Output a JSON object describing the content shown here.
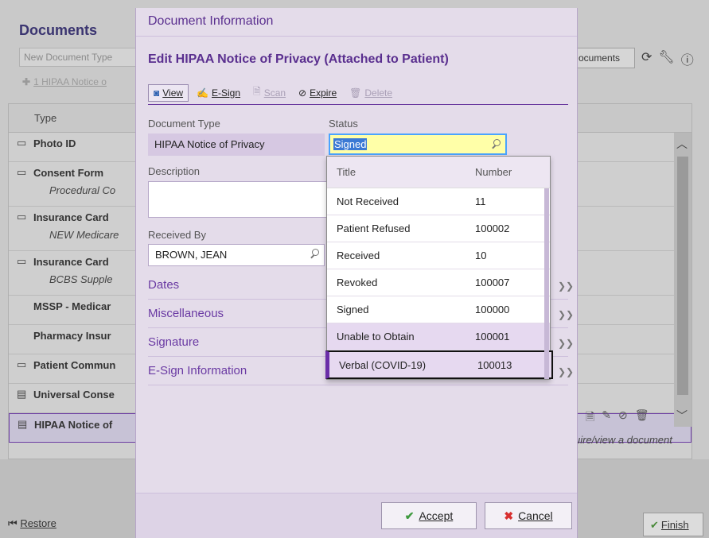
{
  "background": {
    "title": "Documents",
    "new_doc_placeholder": "New Document Type",
    "attach_label": "1 HIPAA Notice o",
    "right_btn_label": "ocuments",
    "grid_header": "Type",
    "rows": [
      {
        "label": "Photo ID",
        "sub": "",
        "icon": "document-icon"
      },
      {
        "label": "Consent Form",
        "sub": "Procedural Co",
        "icon": "document-icon"
      },
      {
        "label": "Insurance Card",
        "sub": "NEW Medicare",
        "icon": "document-icon"
      },
      {
        "label": "Insurance Card",
        "sub": "BCBS Supple",
        "icon": "document-icon"
      },
      {
        "label": "MSSP - Medicar",
        "sub": "",
        "icon": ""
      },
      {
        "label": "Pharmacy Insur",
        "sub": "",
        "icon": ""
      },
      {
        "label": "Patient Commun",
        "sub": "",
        "icon": "document-icon"
      },
      {
        "label": "Universal Conse",
        "sub": "",
        "icon": "signed-document-icon"
      },
      {
        "label": "HIPAA Notice of",
        "sub": "",
        "icon": "signed-document-icon"
      }
    ],
    "hint": "uire/view a document",
    "restore_label": "Restore",
    "finish_label": "Finish"
  },
  "modal": {
    "header": "Document Information",
    "subtitle": "Edit HIPAA Notice of Privacy (Attached to Patient)",
    "toolbar": {
      "view": "View",
      "esign": "E-Sign",
      "scan": "Scan",
      "expire": "Expire",
      "delete": "Delete"
    },
    "document_type_label": "Document Type",
    "document_type_value": "HIPAA Notice of Privacy",
    "status_label": "Status",
    "status_value": "Signed",
    "description_label": "Description",
    "description_value": "",
    "received_by_label": "Received By",
    "received_by_value": "BROWN, JEAN",
    "sections": [
      "Dates",
      "Miscellaneous",
      "Signature",
      "E-Sign Information"
    ],
    "accept_label": "Accept",
    "cancel_label": "Cancel"
  },
  "dropdown": {
    "col_title": "Title",
    "col_number": "Number",
    "options": [
      {
        "title": "Not Received",
        "number": "11"
      },
      {
        "title": "Patient Refused",
        "number": "100002"
      },
      {
        "title": "Received",
        "number": "10"
      },
      {
        "title": "Revoked",
        "number": "100007"
      },
      {
        "title": "Signed",
        "number": "100000"
      },
      {
        "title": "Unable to Obtain",
        "number": "100001"
      },
      {
        "title": "Verbal (COVID-19)",
        "number": "100013"
      }
    ]
  },
  "colors": {
    "accent_purple": "#5a2f8f",
    "modal_bg": "#e4dcea",
    "status_highlight": "#ffffa8"
  }
}
